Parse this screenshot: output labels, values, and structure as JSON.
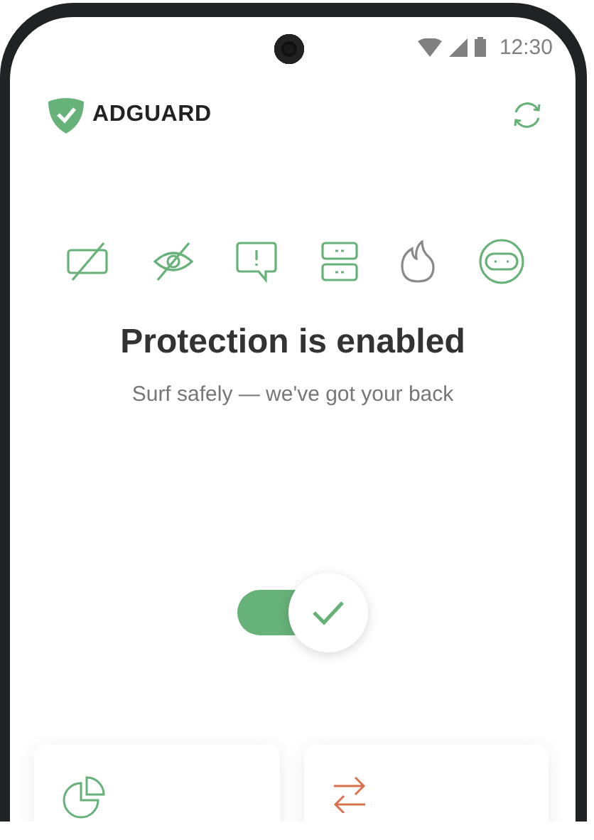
{
  "status_bar": {
    "time": "12:30"
  },
  "app_bar": {
    "logo_text": "ADGUARD"
  },
  "features": [
    {
      "kind": "ads",
      "active": true
    },
    {
      "kind": "tracking",
      "active": true
    },
    {
      "kind": "annoyances",
      "active": true
    },
    {
      "kind": "dns",
      "active": true
    },
    {
      "kind": "firewall",
      "active": false
    },
    {
      "kind": "stealth",
      "active": true
    }
  ],
  "title": "Protection is enabled",
  "subtitle": "Surf safely — we've got your back",
  "protection_switch": {
    "on": true
  },
  "cards": [
    {
      "kind": "statistics"
    },
    {
      "kind": "traffic"
    }
  ]
}
